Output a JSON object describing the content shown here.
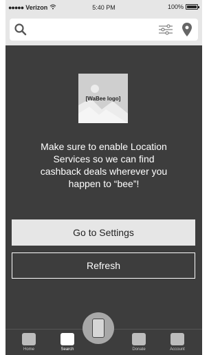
{
  "status_bar": {
    "signal_dots": "●●●●●",
    "carrier": "Verizon",
    "time": "5:40 PM",
    "battery_percent": "100%",
    "battery_level": 1.0
  },
  "search": {
    "placeholder": "",
    "icons": [
      "search-icon",
      "filter-icon",
      "location-pin-icon"
    ]
  },
  "main": {
    "logo_text": "[WaBee logo]",
    "message": "Make sure to enable Location Services so we can find cashback deals wherever you happen to “bee”!",
    "settings_button": "Go to Settings",
    "refresh_button": "Refresh"
  },
  "tabs": [
    {
      "label": "Home",
      "active": false
    },
    {
      "label": "Search",
      "active": true
    },
    {
      "label": "Donate",
      "active": false
    },
    {
      "label": "Account",
      "active": false
    }
  ],
  "colors": {
    "background": "#3d3d3d",
    "header": "#e6e6e6",
    "button_fill": "#e6e6e6",
    "text_light": "#ffffff"
  }
}
